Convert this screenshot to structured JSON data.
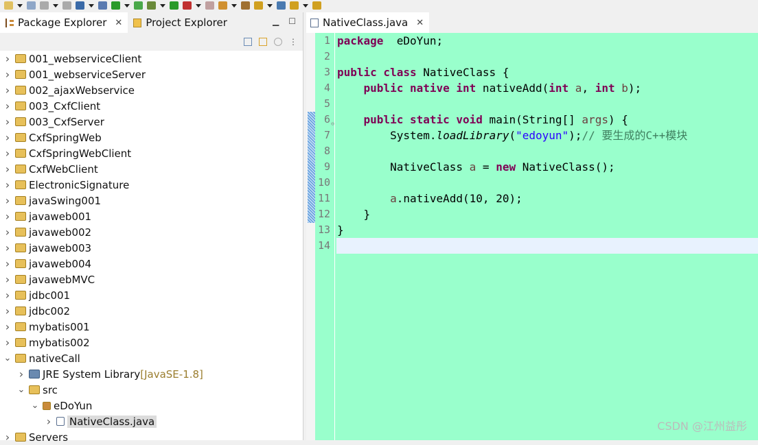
{
  "toolbar": {
    "icons": [
      "new-icon",
      "new-dropdown",
      "save-icon",
      "save-all-icon",
      "terminal-icon",
      "search-icon",
      "spring-boot-icon",
      "spring-icon",
      "debug-icon",
      "run-icon",
      "run-server-icon",
      "stop-icon",
      "open-type-icon",
      "package-icon",
      "next-annotation-icon",
      "prev-annotation-icon",
      "back-icon",
      "forward-icon"
    ]
  },
  "left": {
    "tabs": [
      {
        "label": "Package Explorer",
        "active": true
      },
      {
        "label": "Project Explorer",
        "active": false
      }
    ],
    "tree": [
      {
        "label": "001_webserviceClient",
        "depth": 0,
        "exp": "c"
      },
      {
        "label": "001_webserviceServer",
        "depth": 0,
        "exp": "c"
      },
      {
        "label": "002_ajaxWebservice",
        "depth": 0,
        "exp": "c"
      },
      {
        "label": "003_CxfClient",
        "depth": 0,
        "exp": "c"
      },
      {
        "label": "003_CxfServer",
        "depth": 0,
        "exp": "c"
      },
      {
        "label": "CxfSpringWeb",
        "depth": 0,
        "exp": "c"
      },
      {
        "label": "CxfSpringWebClient",
        "depth": 0,
        "exp": "c"
      },
      {
        "label": "CxfWebClient",
        "depth": 0,
        "exp": "c"
      },
      {
        "label": "ElectronicSignature",
        "depth": 0,
        "exp": "c"
      },
      {
        "label": "javaSwing001",
        "depth": 0,
        "exp": "c"
      },
      {
        "label": "javaweb001",
        "depth": 0,
        "exp": "c"
      },
      {
        "label": "javaweb002",
        "depth": 0,
        "exp": "c"
      },
      {
        "label": "javaweb003",
        "depth": 0,
        "exp": "c"
      },
      {
        "label": "javaweb004",
        "depth": 0,
        "exp": "c"
      },
      {
        "label": "javawebMVC",
        "depth": 0,
        "exp": "c"
      },
      {
        "label": "jdbc001",
        "depth": 0,
        "exp": "c"
      },
      {
        "label": "jdbc002",
        "depth": 0,
        "exp": "c"
      },
      {
        "label": "mybatis001",
        "depth": 0,
        "exp": "c"
      },
      {
        "label": "mybatis002",
        "depth": 0,
        "exp": "c"
      },
      {
        "label": "nativeCall",
        "depth": 0,
        "exp": "e"
      },
      {
        "label": "JRE System Library",
        "decoration": "[JavaSE-1.8]",
        "depth": 1,
        "exp": "c",
        "icon": "library"
      },
      {
        "label": "src",
        "depth": 1,
        "exp": "e",
        "icon": "folder"
      },
      {
        "label": "eDoYun",
        "depth": 2,
        "exp": "e",
        "icon": "package"
      },
      {
        "label": "NativeClass.java",
        "depth": 3,
        "exp": "c",
        "icon": "java",
        "selected": true
      },
      {
        "label": "Servers",
        "depth": 0,
        "exp": "c"
      }
    ]
  },
  "editor": {
    "tab": "NativeClass.java",
    "lines": [
      [
        [
          "kw",
          "package"
        ],
        [
          "",
          "  eDoYun;"
        ]
      ],
      [],
      [
        [
          "kw",
          "public class"
        ],
        [
          "",
          " NativeClass {"
        ]
      ],
      [
        [
          "",
          "    "
        ],
        [
          "kw",
          "public native int"
        ],
        [
          "",
          " nativeAdd("
        ],
        [
          "kw",
          "int"
        ],
        [
          "var",
          " a"
        ],
        [
          "",
          ", "
        ],
        [
          "kw",
          "int"
        ],
        [
          "var",
          " b"
        ],
        [
          "",
          ");"
        ]
      ],
      [],
      [
        [
          "",
          "    "
        ],
        [
          "kw",
          "public static void"
        ],
        [
          "",
          " main(String[] "
        ],
        [
          "var",
          "args"
        ],
        [
          "",
          ") {"
        ]
      ],
      [
        [
          "",
          "        System."
        ],
        [
          "it",
          "loadLibrary"
        ],
        [
          "",
          "("
        ],
        [
          "str",
          "\"edoyun\""
        ],
        [
          "",
          ");"
        ],
        [
          "cm",
          "// 要生成的C++模块"
        ]
      ],
      [],
      [
        [
          "",
          "        NativeClass "
        ],
        [
          "var",
          "a"
        ],
        [
          "",
          " = "
        ],
        [
          "kw",
          "new"
        ],
        [
          "",
          " NativeClass();"
        ]
      ],
      [],
      [
        [
          "",
          "        "
        ],
        [
          "var",
          "a"
        ],
        [
          "",
          ".nativeAdd(10, 20);"
        ]
      ],
      [
        [
          "",
          "    }"
        ]
      ],
      [
        [
          "",
          "}"
        ]
      ],
      []
    ],
    "current_line": 14
  },
  "watermark": "CSDN @江州益彤",
  "colors": {
    "editor_bg": "#99ffcc",
    "keyword": "#7f0055",
    "string": "#2a00ff",
    "comment": "#3f7f5f",
    "current_line": "#e8f2fe"
  }
}
